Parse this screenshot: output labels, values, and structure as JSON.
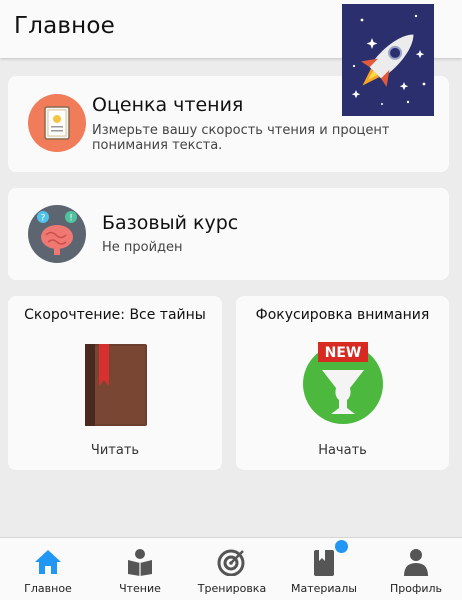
{
  "header": {
    "title": "Главное"
  },
  "cards": {
    "reading_test": {
      "title": "Оценка чтения",
      "subtitle": "Измерьте вашу скорость чтения и процент понимания текста."
    },
    "basic_course": {
      "title": "Базовый курс",
      "subtitle": "Не пройден"
    }
  },
  "tiles": {
    "speed_reading": {
      "title": "Скорочтение: Все тайны",
      "action": "Читать"
    },
    "focus": {
      "title": "Фокусировка внимания",
      "action": "Начать",
      "badge": "NEW"
    }
  },
  "nav": {
    "items": [
      {
        "label": "Главное",
        "active": true
      },
      {
        "label": "Чтение"
      },
      {
        "label": "Тренировка"
      },
      {
        "label": "Материалы",
        "has_notification": true
      },
      {
        "label": "Профиль"
      }
    ]
  },
  "colors": {
    "accent": "#2196f3",
    "inactive_icon": "#555555",
    "background": "#ececec"
  }
}
